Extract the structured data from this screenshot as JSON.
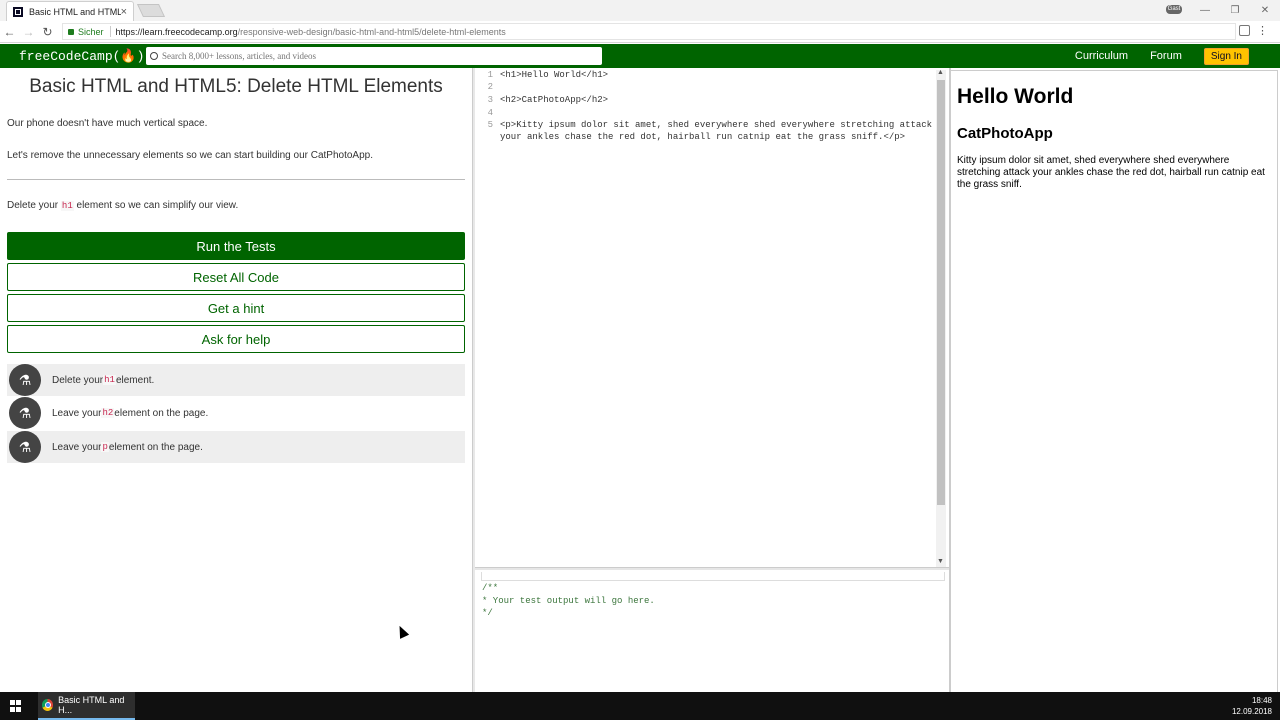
{
  "browser": {
    "tab_title": "Basic HTML and HTML5:",
    "tab_close": "×",
    "window_controls": [
      "—",
      "❐",
      "✕"
    ],
    "user_label": "Gast",
    "secure_label": "Sicher",
    "url_host": "https://learn.freecodecamp.org",
    "url_path": "/responsive-web-design/basic-html-and-html5/delete-html-elements"
  },
  "fcc_nav": {
    "logo": "freeCodeCamp(🔥)",
    "search_placeholder": "Search 8,000+ lessons, articles, and videos",
    "links": [
      "Curriculum",
      "Forum"
    ],
    "sign_in": "Sign In"
  },
  "challenge": {
    "title": "Basic HTML and HTML5: Delete HTML Elements",
    "desc1": "Our phone doesn't have much vertical space.",
    "desc2": "Let's remove the unnecessary elements so we can start building our CatPhotoApp.",
    "instruction_pre": "Delete your ",
    "instruction_code": "h1",
    "instruction_post": " element so we can simplify our view.",
    "buttons": {
      "run": "Run the Tests",
      "reset": "Reset All Code",
      "hint": "Get a hint",
      "help": "Ask for help"
    },
    "tests": [
      {
        "pre": "Delete your ",
        "code": "h1",
        "post": " element."
      },
      {
        "pre": "Leave your ",
        "code": "h2",
        "post": " element on the page."
      },
      {
        "pre": "Leave your ",
        "code": "p",
        "post": " element on the page."
      }
    ]
  },
  "editor": {
    "line_numbers": [
      "1",
      "2",
      "3",
      "4",
      "5",
      ""
    ],
    "lines": [
      "<h1>Hello World</h1>",
      "",
      "<h2>CatPhotoApp</h2>",
      "",
      "<p>Kitty ipsum dolor sit amet, shed everywhere shed everywhere stretching attack",
      "your ankles chase the red dot, hairball run catnip eat the grass sniff.</p>"
    ]
  },
  "output": {
    "lines": [
      "/**",
      "* Your test output will go here.",
      "*/"
    ]
  },
  "preview": {
    "h1": "Hello World",
    "h2": "CatPhotoApp",
    "p": "Kitty ipsum dolor sit amet, shed everywhere shed everywhere stretching attack your ankles chase the red dot, hairball run catnip eat the grass sniff."
  },
  "taskbar": {
    "app_label": "Basic HTML and H...",
    "time": "18:48",
    "date": "12.09.2018"
  }
}
